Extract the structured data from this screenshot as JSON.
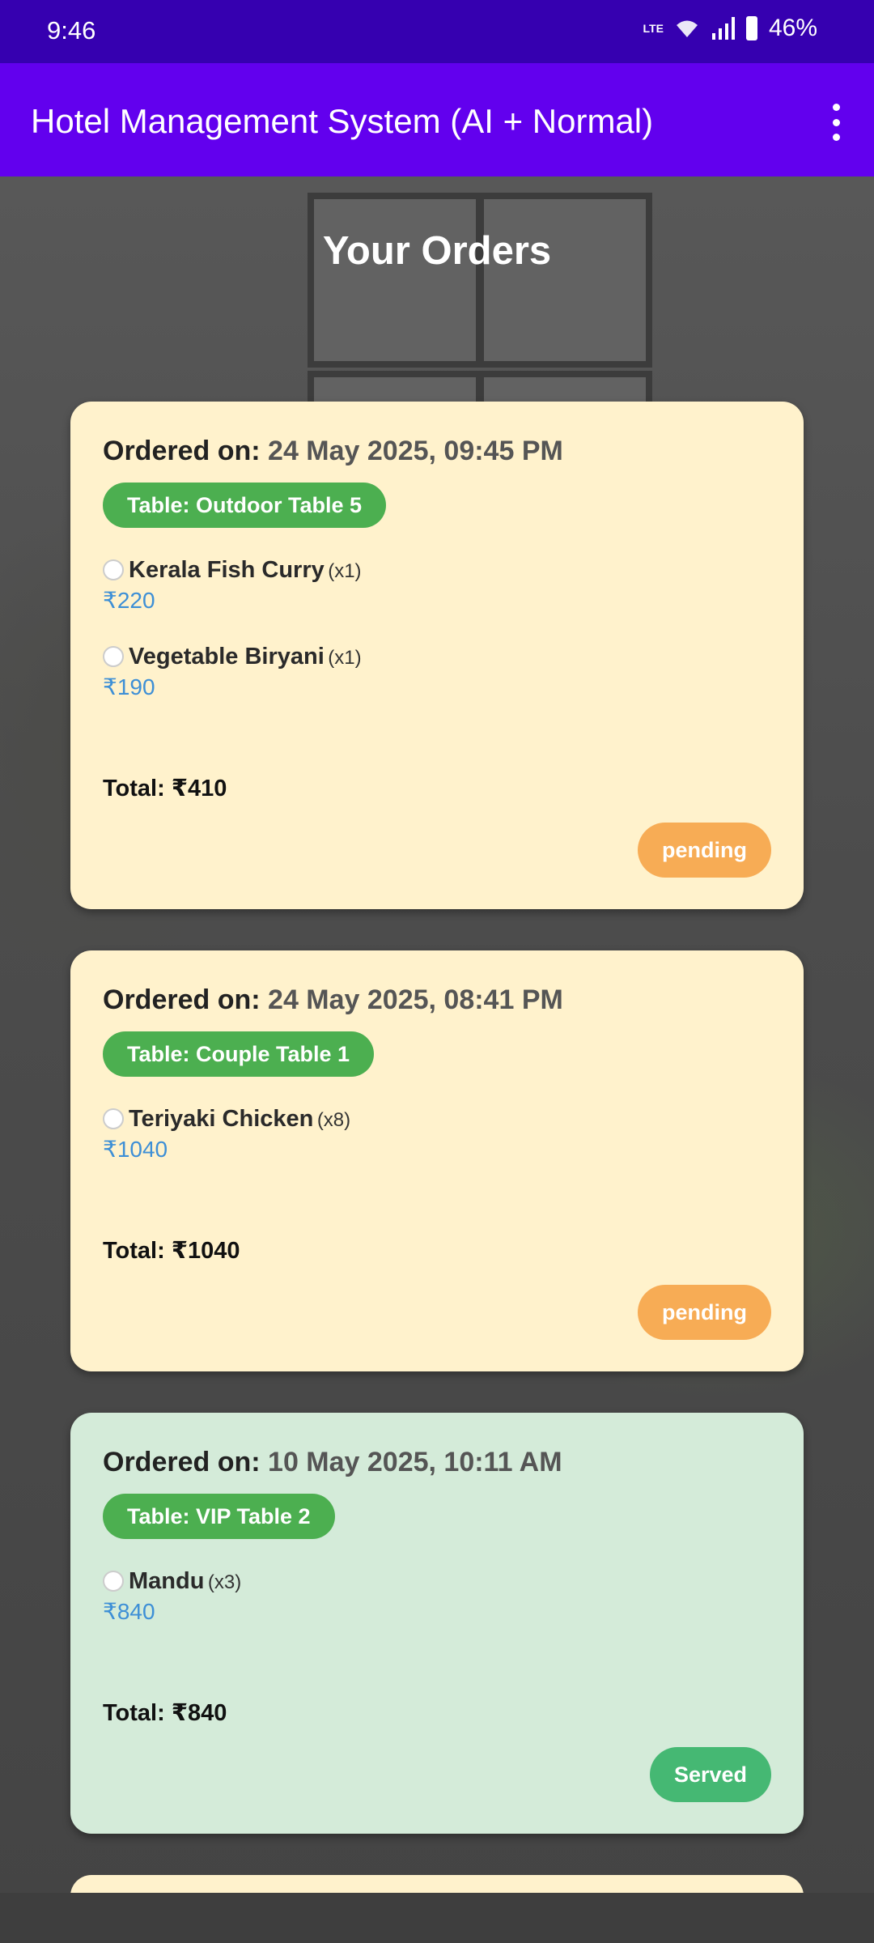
{
  "status_bar": {
    "time": "9:46",
    "network": "LTE",
    "battery": "46%"
  },
  "app_bar": {
    "title": "Hotel Management System (AI + Normal)"
  },
  "page": {
    "heading": "Your Orders"
  },
  "orders": [
    {
      "ordered_label": "Ordered on:",
      "date": "24 May 2025, 09:45 PM",
      "table": "Table: Outdoor Table 5",
      "items": [
        {
          "name": "Kerala Fish Curry",
          "qty": "(x1)",
          "price": "₹220"
        },
        {
          "name": "Vegetable Biryani",
          "qty": "(x1)",
          "price": "₹190"
        }
      ],
      "total": "Total: ₹410",
      "status": "pending"
    },
    {
      "ordered_label": "Ordered on:",
      "date": "24 May 2025, 08:41 PM",
      "table": "Table: Couple Table 1",
      "items": [
        {
          "name": "Teriyaki Chicken",
          "qty": "(x8)",
          "price": "₹1040"
        }
      ],
      "total": "Total: ₹1040",
      "status": "pending"
    },
    {
      "ordered_label": "Ordered on:",
      "date": "10 May 2025, 10:11 AM",
      "table": "Table: VIP Table 2",
      "items": [
        {
          "name": "Mandu",
          "qty": "(x3)",
          "price": "₹840"
        }
      ],
      "total": "Total: ₹840",
      "status": "Served"
    }
  ],
  "colors": {
    "status_bar": "#3600b0",
    "app_bar": "#6200ee",
    "pending_card": "#fff2cc",
    "served_card": "#d4ebd9",
    "table_pill": "#4caf50",
    "pending_pill": "#f7ac55",
    "served_pill": "#45b873",
    "price": "#3d8fd6"
  }
}
